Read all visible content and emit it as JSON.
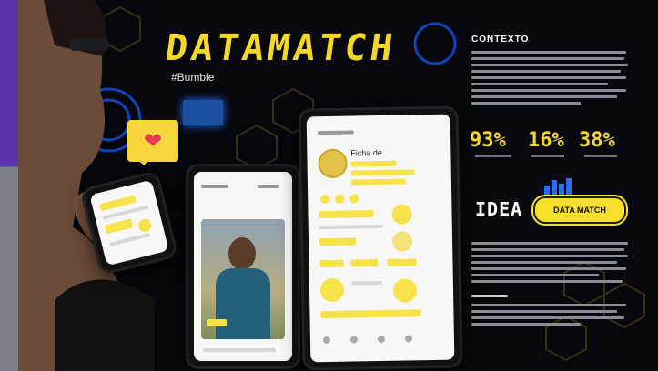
{
  "brand": {
    "title": "DATAMATCH",
    "subtitle": "#Bumble"
  },
  "panel": {
    "heading_1": "CONTEXTO",
    "stats": [
      "93%",
      "16%",
      "38%"
    ],
    "idea_label": "IDEA",
    "cta_label": "DATA MATCH"
  },
  "profile": {
    "name": "Ficha de"
  },
  "colors": {
    "accent": "#f3d82a",
    "purple": "#5a34a8",
    "blue": "#1d6cff"
  }
}
